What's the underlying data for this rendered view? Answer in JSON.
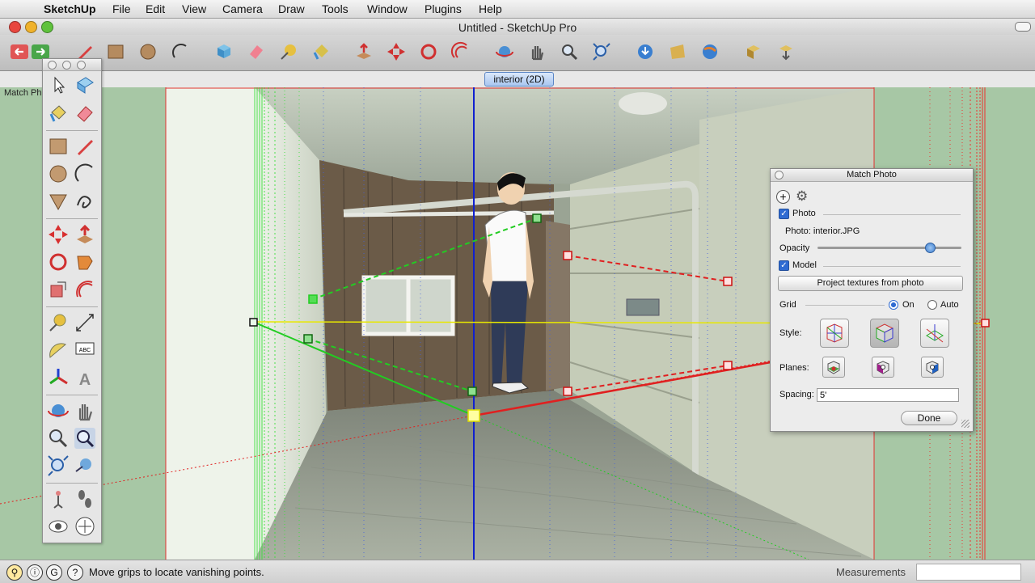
{
  "menubar": {
    "app_name": "SketchUp",
    "items": [
      "File",
      "Edit",
      "View",
      "Camera",
      "Draw",
      "Tools",
      "Window",
      "Plugins",
      "Help"
    ]
  },
  "window": {
    "title": "Untitled - SketchUp Pro"
  },
  "toolbar": {
    "icons": [
      "undo-icon",
      "redo-icon",
      "pencil-icon",
      "rectangle-icon",
      "circle-icon",
      "arc-icon",
      "select-icon",
      "eraser-icon",
      "tape-icon",
      "paint-icon",
      "push-pull-icon",
      "move-icon",
      "rotate-icon",
      "offset-icon",
      "orbit-icon",
      "pan-icon",
      "zoom-icon",
      "zoom-extents-icon",
      "get-models-icon",
      "share-model-icon",
      "google-earth-icon",
      "components-icon",
      "share-component-icon"
    ]
  },
  "scene_tab": {
    "label": "interior (2D)"
  },
  "viewport": {
    "match_photo_label": "Match Phot"
  },
  "palette": {
    "icons": [
      "select-icon",
      "component-icon",
      "paint-bucket-icon",
      "eraser-icon",
      "rectangle-icon",
      "line-icon",
      "circle-icon",
      "arc-icon",
      "polygon-icon",
      "freehand-icon",
      "move-icon",
      "push-pull-icon",
      "rotate-icon",
      "follow-me-icon",
      "scale-icon",
      "offset-icon",
      "tape-measure-icon",
      "dimension-icon",
      "protractor-icon",
      "text-icon",
      "axes-icon",
      "3d-text-icon",
      "orbit-icon",
      "pan-icon",
      "zoom-icon",
      "zoom-window-icon",
      "zoom-extents-icon",
      "previous-view-icon",
      "position-camera-icon",
      "walk-icon",
      "look-around-icon",
      "section-plane-icon"
    ]
  },
  "match_photo": {
    "title": "Match Photo",
    "photo_label": "Photo",
    "photo_checked": true,
    "photo_file": "Photo: interior.JPG",
    "opacity_label": "Opacity",
    "opacity_value": 0.78,
    "model_label": "Model",
    "model_checked": true,
    "project_button": "Project textures from photo",
    "grid_label": "Grid",
    "grid_on": "On",
    "grid_auto": "Auto",
    "grid_selected": "On",
    "style_label": "Style:",
    "planes_label": "Planes:",
    "spacing_label": "Spacing:",
    "spacing_value": "5'",
    "done_button": "Done"
  },
  "status": {
    "message": "Move grips to locate vanishing points.",
    "measurements_label": "Measurements",
    "measurements_value": ""
  },
  "colors": {
    "axis_red": "#e02020",
    "axis_green": "#22cc22",
    "axis_blue": "#1020d0",
    "horizon": "#e8e800",
    "photo_tint": "#8a9580"
  }
}
